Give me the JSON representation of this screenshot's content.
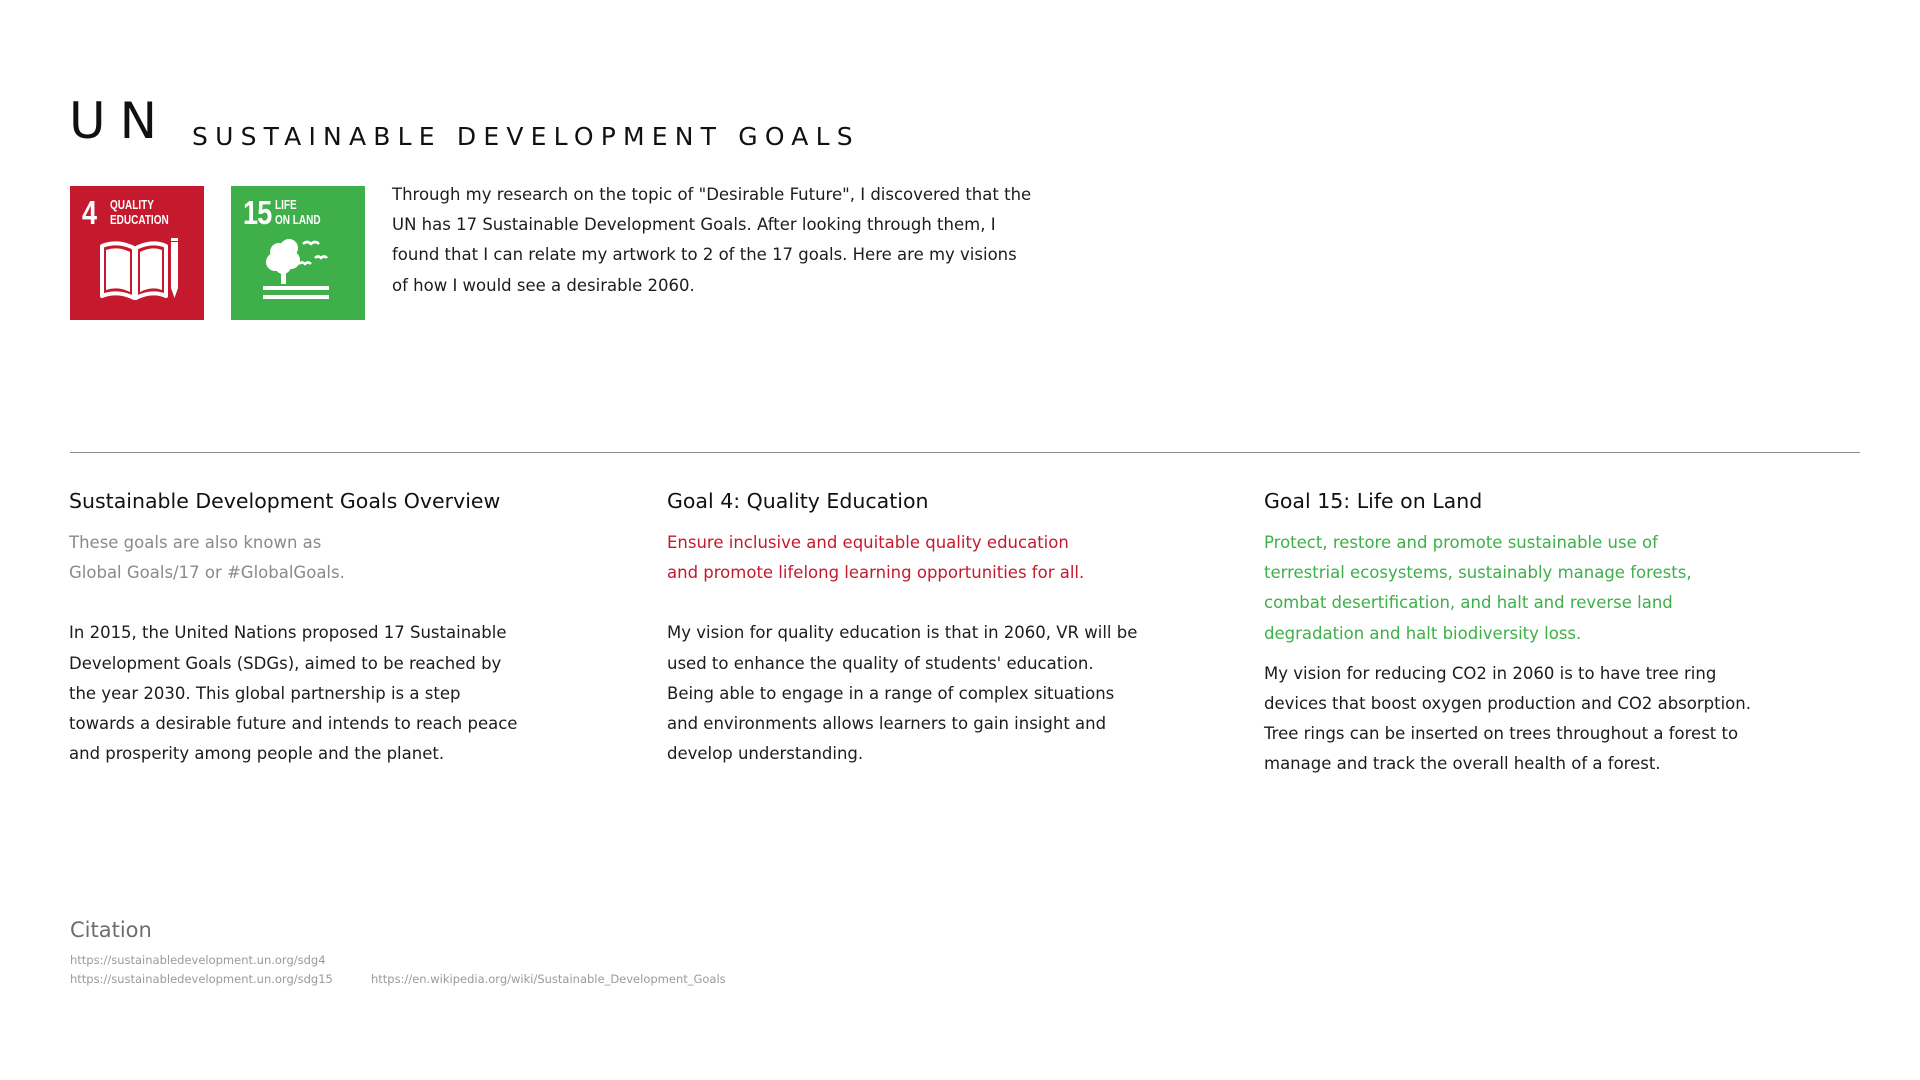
{
  "header": {
    "title_main": "UN",
    "title_sub": "SUSTAINABLE DEVELOPMENT GOALS"
  },
  "tiles": [
    {
      "number": "4",
      "label": "QUALITY\nEDUCATION",
      "color": "#c5192d",
      "icon": "book-pencil-icon"
    },
    {
      "number": "15",
      "label": "LIFE\nON LAND",
      "color": "#3eaf49",
      "icon": "tree-birds-icon"
    }
  ],
  "intro": "Through my research on the topic of \"Desirable Future\", I discovered that the UN has 17 Sustainable Development Goals. After looking through them, I found that I can relate my artwork to 2 of the 17 goals. Here are my visions of how I would see a desirable 2060.",
  "columns": {
    "overview": {
      "heading": "Sustainable Development Goals Overview",
      "tagline": "These goals are also known as\nGlobal Goals/17 or #GlobalGoals.",
      "body": "In 2015, the United Nations proposed 17 Sustainable Development Goals (SDGs), aimed to be reached by the year 2030. This global partnership is a step towards a desirable future and intends to reach peace and prosperity among people and the planet."
    },
    "goal4": {
      "heading": "Goal 4: Quality Education",
      "tagline": "Ensure inclusive and equitable quality education\nand promote lifelong learning opportunities for all.",
      "body": "My vision for quality education is that in 2060, VR will be used to enhance the quality of students' education. Being able to engage in a range of complex situations and environments allows learners to gain insight and develop understanding."
    },
    "goal15": {
      "heading": "Goal 15: Life on Land",
      "tagline": "Protect, restore and promote sustainable use of terrestrial ecosystems, sustainably manage forests, combat desertification, and halt and reverse land degradation and halt biodiversity loss.",
      "body": "My vision for reducing CO2 in 2060 is to have tree ring devices that boost oxygen production and CO2 absorption. Tree rings can be inserted on trees throughout a forest to manage and track the overall health of a forest."
    }
  },
  "citation": {
    "heading": "Citation",
    "links": [
      "https://sustainabledevelopment.un.org/sdg4",
      "https://sustainabledevelopment.un.org/sdg15",
      "https://en.wikipedia.org/wiki/Sustainable_Development_Goals"
    ]
  },
  "colors": {
    "goal4_red": "#c5192d",
    "goal15_green": "#3eaf49",
    "muted_gray": "#8a8a8a"
  }
}
